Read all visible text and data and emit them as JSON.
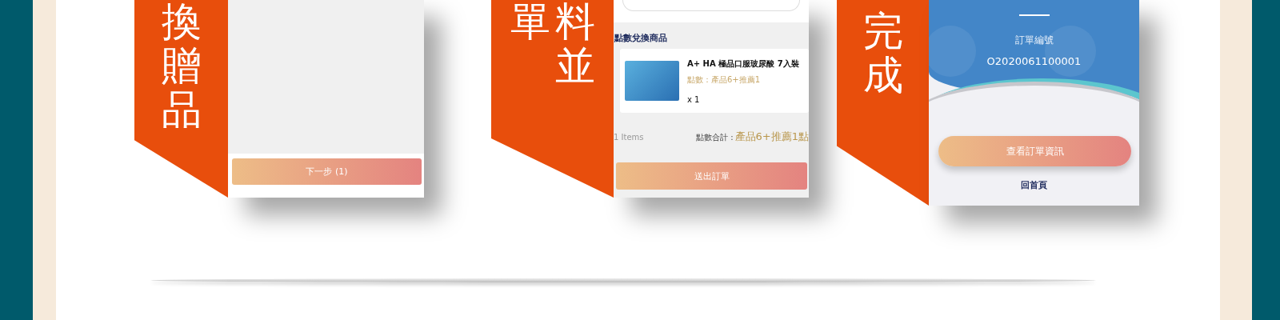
{
  "panels": [
    {
      "kind": "gift",
      "banner": [
        "換贈品"
      ],
      "next_button": "下一步 (1)"
    },
    {
      "kind": "order",
      "banner": [
        "單",
        "料並"
      ],
      "section_title": "點數兌換商品",
      "product": {
        "name": "A+ HA 極品口服玻尿酸 7入裝",
        "points": "點數：產品6+推薦1",
        "quantity": "x 1"
      },
      "items_count": "1 Items",
      "total_label": "點數合計 :",
      "total_value": "產品6+推薦1點",
      "submit_button": "送出訂單"
    },
    {
      "kind": "done",
      "banner": [
        "完成"
      ],
      "order_label": "訂單編號",
      "order_number": "O2020061100001",
      "view_button": "查看訂單資訊",
      "home_link": "回首頁"
    }
  ]
}
